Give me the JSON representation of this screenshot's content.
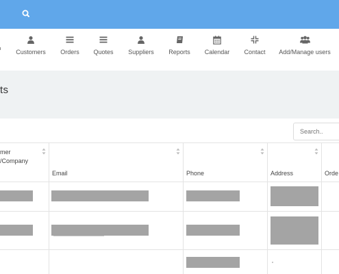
{
  "topbar": {
    "search_icon": "search-icon"
  },
  "nav": {
    "items": [
      {
        "label": "Customers",
        "icon": "user-icon"
      },
      {
        "label": "Orders",
        "icon": "list-icon"
      },
      {
        "label": "Quotes",
        "icon": "list-icon"
      },
      {
        "label": "Suppliers",
        "icon": "user-icon"
      },
      {
        "label": "Reports",
        "icon": "book-icon"
      },
      {
        "label": "Calendar",
        "icon": "calendar-icon"
      },
      {
        "label": "Contact",
        "icon": "compress-icon"
      },
      {
        "label": "Add/Manage users",
        "icon": "users-icon"
      }
    ]
  },
  "page": {
    "title": "ts"
  },
  "table": {
    "search_placeholder": "Search..",
    "columns": [
      {
        "label": "mer\n/Company"
      },
      {
        "label": "Email"
      },
      {
        "label": "Phone"
      },
      {
        "label": "Address"
      },
      {
        "label": "Orde"
      }
    ],
    "sort_icon": "sort-icon"
  },
  "colors": {
    "topbar": "#60a7ea",
    "title_bg": "#eff2f3",
    "redacted": "#a4a4a4"
  }
}
